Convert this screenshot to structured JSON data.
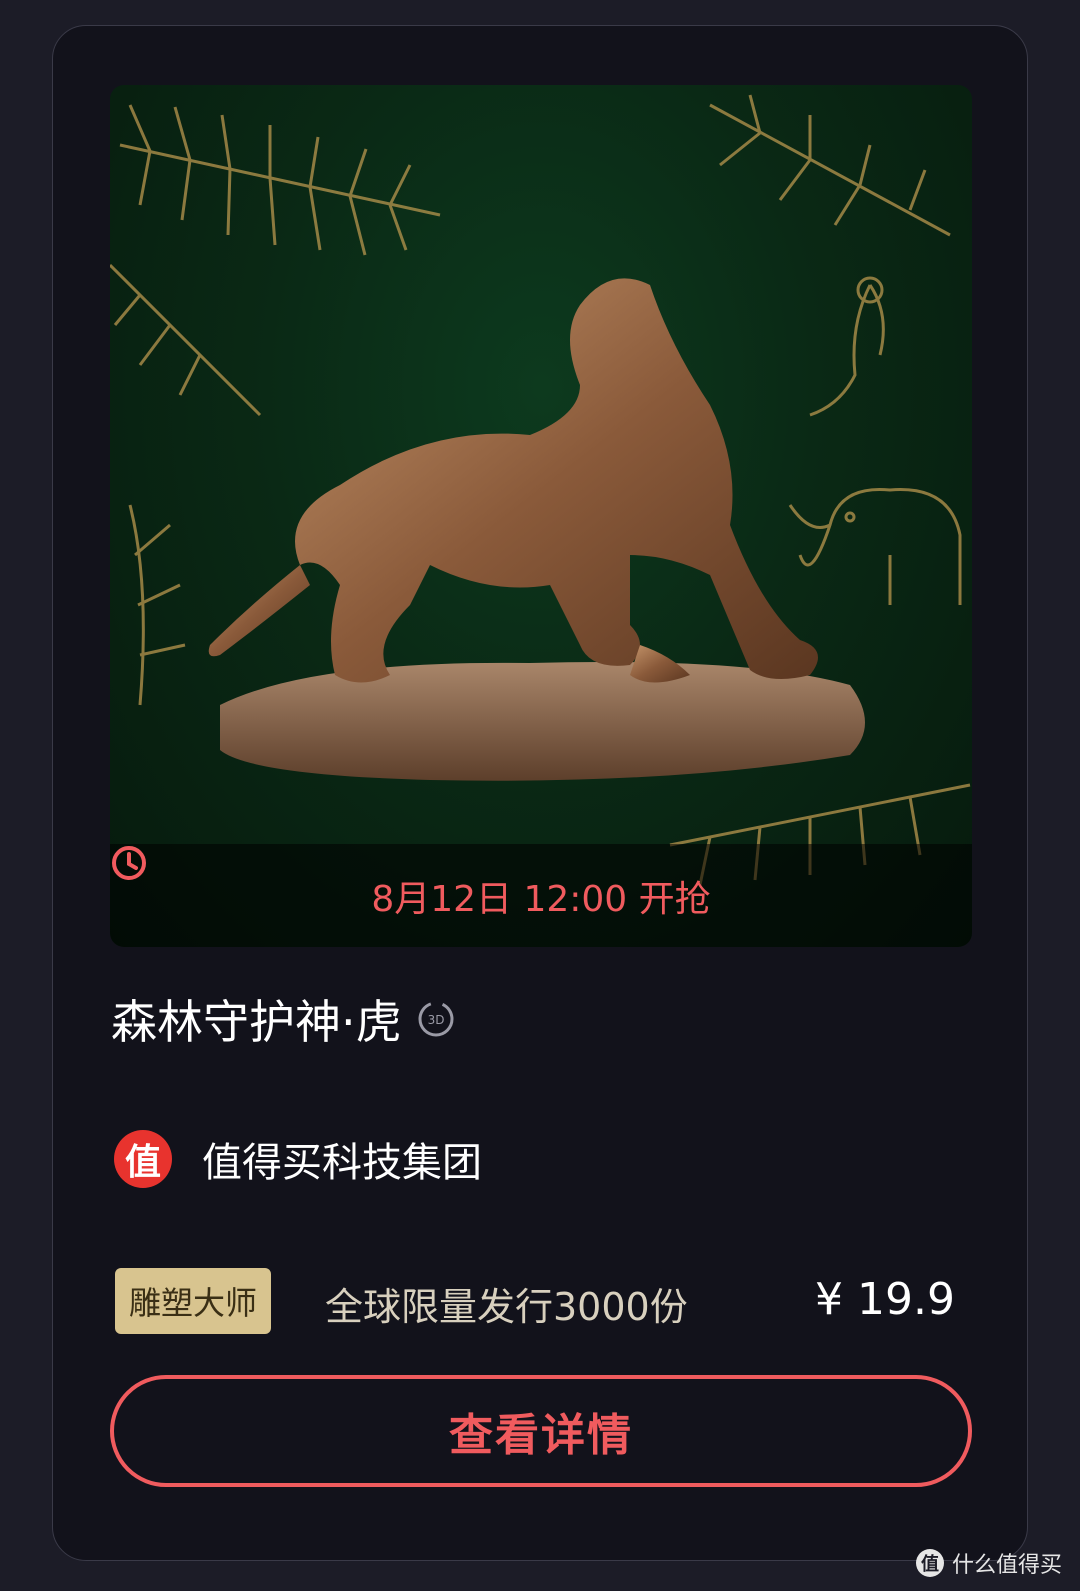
{
  "product": {
    "release_time": "8月12日 12:00 开抢",
    "title": "森林守护神·虎",
    "badge": "3D",
    "issuer_logo_text": "值",
    "issuer_name": "值得买科技集团",
    "tag": "雕塑大师",
    "limit_text": "全球限量发行3000份",
    "price": "¥ 19.9",
    "detail_button": "查看详情"
  },
  "watermark": {
    "logo_text": "值",
    "text": "什么值得买"
  },
  "colors": {
    "accent": "#f05b5e",
    "tag_bg": "#d8c48f",
    "card_bg": "#12121b"
  }
}
